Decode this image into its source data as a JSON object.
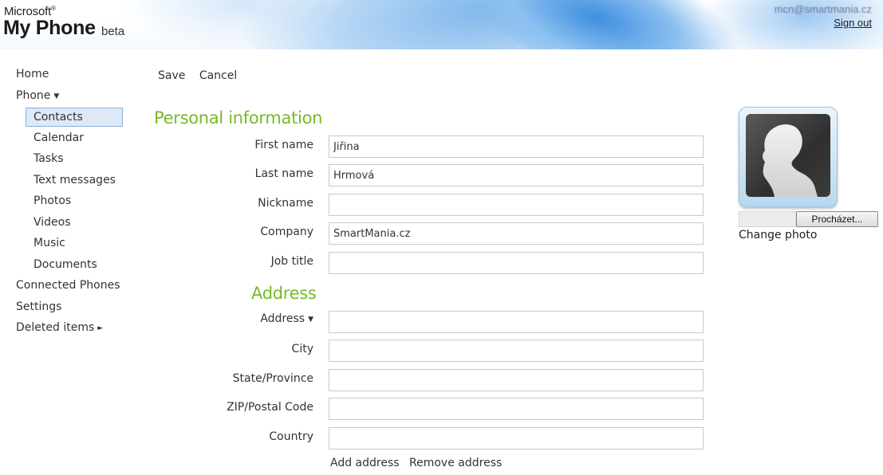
{
  "header": {
    "brand_small": "Microsoft",
    "brand_main": "My Phone",
    "brand_tag": "beta",
    "user_email": "mcn@smartmania.cz",
    "sign_out": "Sign out"
  },
  "nav": {
    "home": "Home",
    "phone": "Phone",
    "contacts": "Contacts",
    "calendar": "Calendar",
    "tasks": "Tasks",
    "text_messages": "Text messages",
    "photos": "Photos",
    "videos": "Videos",
    "music": "Music",
    "documents": "Documents",
    "connected_phones": "Connected Phones",
    "settings": "Settings",
    "deleted_items": "Deleted items"
  },
  "toolbar": {
    "save": "Save",
    "cancel": "Cancel"
  },
  "personal": {
    "title": "Personal information",
    "first_name_label": "First name",
    "first_name": "Jiřina",
    "last_name_label": "Last name",
    "last_name": "Hrmová",
    "nickname_label": "Nickname",
    "nickname": "",
    "company_label": "Company",
    "company": "SmartMania.cz",
    "job_title_label": "Job title",
    "job_title": ""
  },
  "address": {
    "title": "Address",
    "address_label": "Address",
    "address": "",
    "city_label": "City",
    "city": "",
    "state_label": "State/Province",
    "state": "",
    "zip_label": "ZIP/Postal Code",
    "zip": "",
    "country_label": "Country",
    "country": "",
    "add": "Add address",
    "remove": "Remove address"
  },
  "photo": {
    "browse": "Procházet...",
    "change": "Change photo"
  },
  "icons": {
    "avatar": "person-silhouette-icon",
    "dropdown": "triangle-down-icon",
    "submenu": "triangle-right-icon"
  },
  "colors": {
    "accent_green": "#7ab828",
    "selected_bg": "#dde9f7"
  }
}
